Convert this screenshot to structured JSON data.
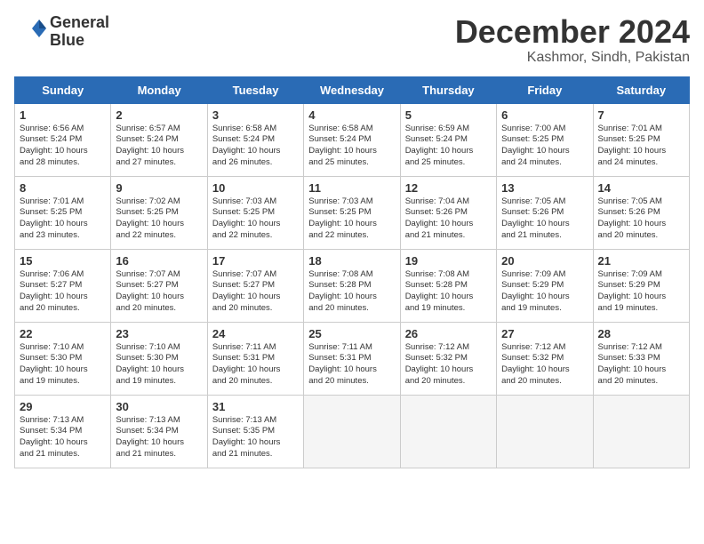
{
  "header": {
    "logo_line1": "General",
    "logo_line2": "Blue",
    "month_title": "December 2024",
    "location": "Kashmor, Sindh, Pakistan"
  },
  "days_of_week": [
    "Sunday",
    "Monday",
    "Tuesday",
    "Wednesday",
    "Thursday",
    "Friday",
    "Saturday"
  ],
  "weeks": [
    [
      {
        "day": "1",
        "info": "Sunrise: 6:56 AM\nSunset: 5:24 PM\nDaylight: 10 hours\nand 28 minutes."
      },
      {
        "day": "2",
        "info": "Sunrise: 6:57 AM\nSunset: 5:24 PM\nDaylight: 10 hours\nand 27 minutes."
      },
      {
        "day": "3",
        "info": "Sunrise: 6:58 AM\nSunset: 5:24 PM\nDaylight: 10 hours\nand 26 minutes."
      },
      {
        "day": "4",
        "info": "Sunrise: 6:58 AM\nSunset: 5:24 PM\nDaylight: 10 hours\nand 25 minutes."
      },
      {
        "day": "5",
        "info": "Sunrise: 6:59 AM\nSunset: 5:24 PM\nDaylight: 10 hours\nand 25 minutes."
      },
      {
        "day": "6",
        "info": "Sunrise: 7:00 AM\nSunset: 5:25 PM\nDaylight: 10 hours\nand 24 minutes."
      },
      {
        "day": "7",
        "info": "Sunrise: 7:01 AM\nSunset: 5:25 PM\nDaylight: 10 hours\nand 24 minutes."
      }
    ],
    [
      {
        "day": "8",
        "info": "Sunrise: 7:01 AM\nSunset: 5:25 PM\nDaylight: 10 hours\nand 23 minutes."
      },
      {
        "day": "9",
        "info": "Sunrise: 7:02 AM\nSunset: 5:25 PM\nDaylight: 10 hours\nand 22 minutes."
      },
      {
        "day": "10",
        "info": "Sunrise: 7:03 AM\nSunset: 5:25 PM\nDaylight: 10 hours\nand 22 minutes."
      },
      {
        "day": "11",
        "info": "Sunrise: 7:03 AM\nSunset: 5:25 PM\nDaylight: 10 hours\nand 22 minutes."
      },
      {
        "day": "12",
        "info": "Sunrise: 7:04 AM\nSunset: 5:26 PM\nDaylight: 10 hours\nand 21 minutes."
      },
      {
        "day": "13",
        "info": "Sunrise: 7:05 AM\nSunset: 5:26 PM\nDaylight: 10 hours\nand 21 minutes."
      },
      {
        "day": "14",
        "info": "Sunrise: 7:05 AM\nSunset: 5:26 PM\nDaylight: 10 hours\nand 20 minutes."
      }
    ],
    [
      {
        "day": "15",
        "info": "Sunrise: 7:06 AM\nSunset: 5:27 PM\nDaylight: 10 hours\nand 20 minutes."
      },
      {
        "day": "16",
        "info": "Sunrise: 7:07 AM\nSunset: 5:27 PM\nDaylight: 10 hours\nand 20 minutes."
      },
      {
        "day": "17",
        "info": "Sunrise: 7:07 AM\nSunset: 5:27 PM\nDaylight: 10 hours\nand 20 minutes."
      },
      {
        "day": "18",
        "info": "Sunrise: 7:08 AM\nSunset: 5:28 PM\nDaylight: 10 hours\nand 20 minutes."
      },
      {
        "day": "19",
        "info": "Sunrise: 7:08 AM\nSunset: 5:28 PM\nDaylight: 10 hours\nand 19 minutes."
      },
      {
        "day": "20",
        "info": "Sunrise: 7:09 AM\nSunset: 5:29 PM\nDaylight: 10 hours\nand 19 minutes."
      },
      {
        "day": "21",
        "info": "Sunrise: 7:09 AM\nSunset: 5:29 PM\nDaylight: 10 hours\nand 19 minutes."
      }
    ],
    [
      {
        "day": "22",
        "info": "Sunrise: 7:10 AM\nSunset: 5:30 PM\nDaylight: 10 hours\nand 19 minutes."
      },
      {
        "day": "23",
        "info": "Sunrise: 7:10 AM\nSunset: 5:30 PM\nDaylight: 10 hours\nand 19 minutes."
      },
      {
        "day": "24",
        "info": "Sunrise: 7:11 AM\nSunset: 5:31 PM\nDaylight: 10 hours\nand 20 minutes."
      },
      {
        "day": "25",
        "info": "Sunrise: 7:11 AM\nSunset: 5:31 PM\nDaylight: 10 hours\nand 20 minutes."
      },
      {
        "day": "26",
        "info": "Sunrise: 7:12 AM\nSunset: 5:32 PM\nDaylight: 10 hours\nand 20 minutes."
      },
      {
        "day": "27",
        "info": "Sunrise: 7:12 AM\nSunset: 5:32 PM\nDaylight: 10 hours\nand 20 minutes."
      },
      {
        "day": "28",
        "info": "Sunrise: 7:12 AM\nSunset: 5:33 PM\nDaylight: 10 hours\nand 20 minutes."
      }
    ],
    [
      {
        "day": "29",
        "info": "Sunrise: 7:13 AM\nSunset: 5:34 PM\nDaylight: 10 hours\nand 21 minutes."
      },
      {
        "day": "30",
        "info": "Sunrise: 7:13 AM\nSunset: 5:34 PM\nDaylight: 10 hours\nand 21 minutes."
      },
      {
        "day": "31",
        "info": "Sunrise: 7:13 AM\nSunset: 5:35 PM\nDaylight: 10 hours\nand 21 minutes."
      },
      {
        "day": "",
        "info": ""
      },
      {
        "day": "",
        "info": ""
      },
      {
        "day": "",
        "info": ""
      },
      {
        "day": "",
        "info": ""
      }
    ]
  ]
}
